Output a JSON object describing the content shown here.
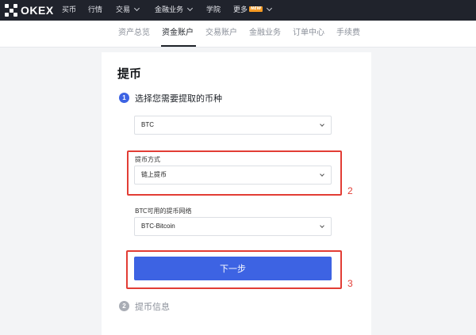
{
  "topnav": {
    "logo_text": "OKEX",
    "items": [
      {
        "label": "买币"
      },
      {
        "label": "行情"
      },
      {
        "label": "交易"
      },
      {
        "label": "金融业务"
      },
      {
        "label": "学院"
      },
      {
        "label": "更多",
        "badge": "NEW"
      }
    ]
  },
  "subnav": {
    "items": [
      {
        "label": "资产总览",
        "active": false
      },
      {
        "label": "资金账户",
        "active": true
      },
      {
        "label": "交易账户",
        "active": false
      },
      {
        "label": "金融业务",
        "active": false
      },
      {
        "label": "订单中心",
        "active": false
      },
      {
        "label": "手续费",
        "active": false
      }
    ]
  },
  "withdraw": {
    "title": "提币",
    "step1": {
      "number": "1",
      "label": "选择您需要提取的币种"
    },
    "currency_select": {
      "value": "BTC"
    },
    "method": {
      "label": "提币方式",
      "value": "链上提币"
    },
    "network": {
      "label": "BTC可用的提币网络",
      "value": "BTC-Bitcoin"
    },
    "next_button": "下一步",
    "step2": {
      "number": "2",
      "label": "提币信息"
    }
  },
  "annotations": {
    "box2_number": "2",
    "box3_number": "3"
  },
  "colors": {
    "nav_bg": "#20232c",
    "accent_blue": "#3d63e3",
    "annotation_red": "#e23d35",
    "badge_orange": "#f59a23",
    "step_inactive": "#a9adb5"
  }
}
